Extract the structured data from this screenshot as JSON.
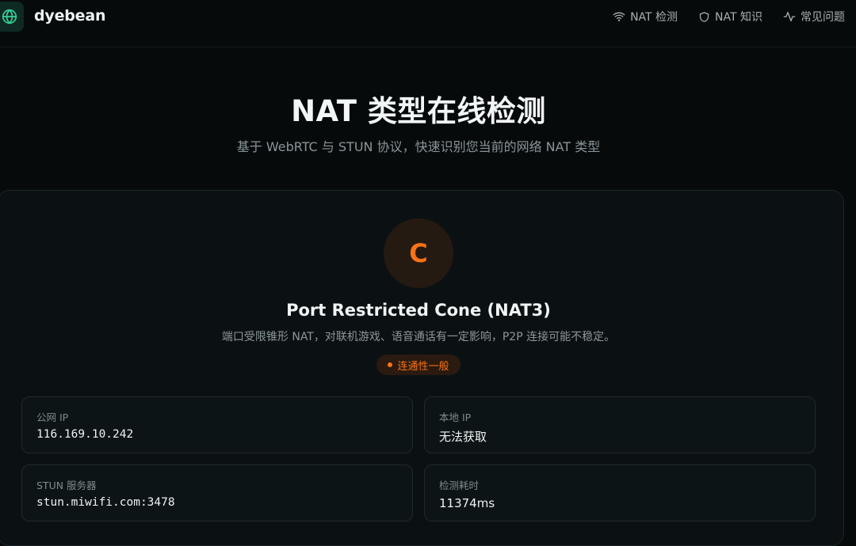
{
  "header": {
    "brand": "dyebean",
    "nav": [
      {
        "label": "NAT 检测",
        "icon": "wifi-icon"
      },
      {
        "label": "NAT 知识",
        "icon": "shield-icon"
      },
      {
        "label": "常见问题",
        "icon": "activity-icon"
      }
    ]
  },
  "hero": {
    "title": "NAT 类型在线检测",
    "subtitle": "基于 WebRTC 与 STUN 协议，快速识别您当前的网络 NAT 类型"
  },
  "result": {
    "grade": "C",
    "nat_type": "Port Restricted Cone (NAT3)",
    "description": "端口受限锥形 NAT，对联机游戏、语音通话有一定影响，P2P 连接可能不稳定。",
    "badge": "连通性一般",
    "accent_color": "#f97316",
    "details": [
      {
        "label": "公网 IP",
        "value": "116.169.10.242"
      },
      {
        "label": "本地 IP",
        "value": "无法获取"
      },
      {
        "label": "STUN 服务器",
        "value": "stun.miwifi.com:3478"
      },
      {
        "label": "检测耗时",
        "value": "11374ms"
      }
    ]
  }
}
